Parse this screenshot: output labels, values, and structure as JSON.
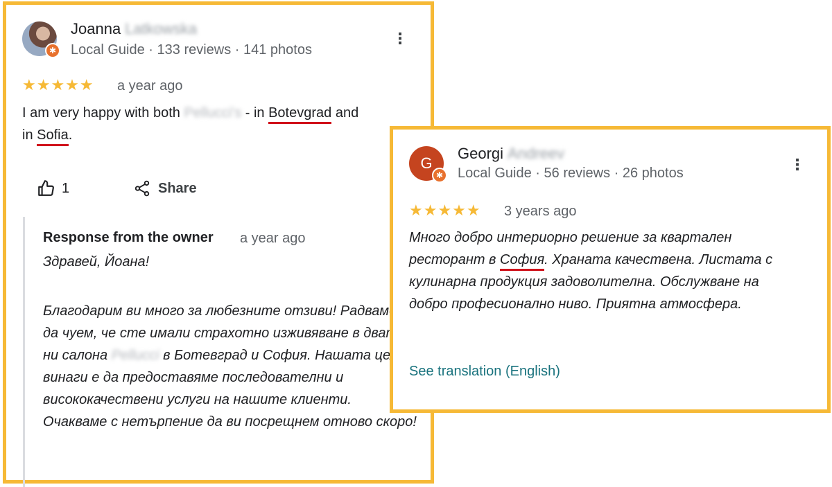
{
  "review1": {
    "name": "Joanna",
    "surname": "Latkowska",
    "meta": "Local Guide · 133 reviews · 141 photos",
    "stars": "★★★★★",
    "time": "a year ago",
    "text_start": "I am very happy with both ",
    "text_blur": "Pellucci's",
    "text_mid": " - in ",
    "place1": "Botevgrad",
    "text_and": " and",
    "text_in": "in ",
    "place2": "Sofia",
    "text_end": ".",
    "likes": "1",
    "share_label": "Share",
    "owner_response": {
      "title": "Response from the owner",
      "time": "a year ago",
      "greeting": "Здравей, Йоана!",
      "text_part1": "Благодарим ви много за любезните отзиви! Радваме се да чуем, че сте имали страхотно изживяване в двата ни салона ",
      "text_blur": "Pellucci",
      "text_part2": " в Ботевград и София. Нашата цел винаги е да предоставяме последователни и висококачествени услуги на нашите клиенти. Очакваме с нетърпение да ви посрещнем отново скоро!"
    }
  },
  "review2": {
    "name": "Georgi",
    "surname": "Andreev",
    "avatar_letter": "G",
    "meta": "Local Guide · 56 reviews · 26 photos",
    "stars": "★★★★★",
    "time": "3 years ago",
    "text_part1": "Много добро интериорно решение за квартален ресторант в ",
    "place": "София",
    "text_part2": ". Храната качествена. Листата с кулинарна продукция задоволителна. Обслужване на добро професионално ниво. Приятна атмосфера.",
    "translate": "See translation (English)"
  },
  "colors": {
    "border": "#f6b936",
    "stars": "#f6b936",
    "underline": "#d0121b",
    "link": "#1a737e"
  }
}
